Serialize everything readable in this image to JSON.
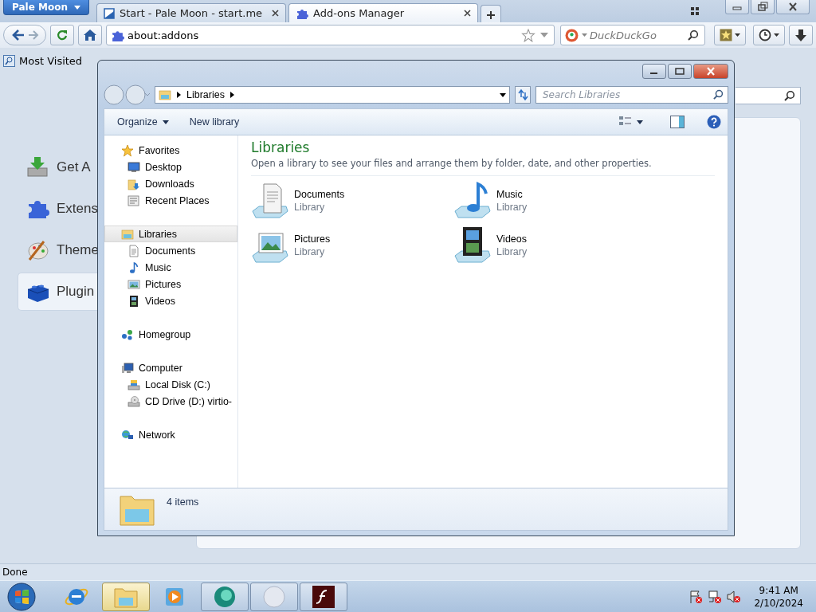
{
  "browser": {
    "app_button": "Pale Moon",
    "tabs": [
      {
        "title": "Start - Pale Moon - start.me",
        "selected": false
      },
      {
        "title": "Add-ons Manager",
        "selected": true
      }
    ],
    "address": "about:addons",
    "search_placeholder": "DuckDuckGo",
    "bookmarks": [
      {
        "label": "Most Visited"
      }
    ],
    "categories": [
      {
        "kind": "download",
        "label": "Get A",
        "selected": false
      },
      {
        "kind": "puzzle",
        "label": "Extens",
        "selected": false
      },
      {
        "kind": "palette",
        "label": "Theme",
        "selected": false
      },
      {
        "kind": "brick",
        "label": "Plugin",
        "selected": true
      }
    ],
    "status": "Done"
  },
  "explorer": {
    "breadcrumb": "Libraries",
    "search_placeholder": "Search Libraries",
    "toolbar": [
      {
        "label": "Organize",
        "dropdown": true
      },
      {
        "label": "New library",
        "dropdown": false
      }
    ],
    "nav": [
      {
        "kind": "star",
        "label": "Favorites",
        "selected": false,
        "children": [
          {
            "kind": "desktop",
            "label": "Desktop",
            "selected": false
          },
          {
            "kind": "downloads",
            "label": "Downloads",
            "selected": false
          },
          {
            "kind": "recent",
            "label": "Recent Places",
            "selected": false
          }
        ]
      },
      {
        "kind": "library",
        "label": "Libraries",
        "selected": true,
        "children": [
          {
            "kind": "documents",
            "label": "Documents",
            "selected": false
          },
          {
            "kind": "music",
            "label": "Music",
            "selected": false
          },
          {
            "kind": "pictures",
            "label": "Pictures",
            "selected": false
          },
          {
            "kind": "videos",
            "label": "Videos",
            "selected": false
          }
        ]
      },
      {
        "kind": "homegroup",
        "label": "Homegroup",
        "selected": false
      },
      {
        "kind": "computer",
        "label": "Computer",
        "selected": false,
        "children": [
          {
            "kind": "disk",
            "label": "Local Disk (C:)",
            "selected": false
          },
          {
            "kind": "cd",
            "label": "CD Drive (D:) virtio-",
            "selected": false
          }
        ]
      },
      {
        "kind": "network",
        "label": "Network",
        "selected": false
      }
    ],
    "heading": "Libraries",
    "description": "Open a library to see your files and arrange them by folder, date, and other properties.",
    "items": [
      {
        "kind": "documents",
        "name": "Documents",
        "type": "Library"
      },
      {
        "kind": "music",
        "name": "Music",
        "type": "Library"
      },
      {
        "kind": "pictures",
        "name": "Pictures",
        "type": "Library"
      },
      {
        "kind": "videos",
        "name": "Videos",
        "type": "Library"
      }
    ],
    "status": "4 items"
  },
  "taskbar": {
    "apps": [
      {
        "kind": "ie",
        "selected": false
      },
      {
        "kind": "explorer",
        "selected": true
      },
      {
        "kind": "media",
        "selected": false
      },
      {
        "kind": "chat",
        "selected": false
      },
      {
        "kind": "sphere",
        "selected": false
      },
      {
        "kind": "flash",
        "selected": false
      }
    ],
    "time": "9:41 AM",
    "date": "2/10/2024"
  }
}
